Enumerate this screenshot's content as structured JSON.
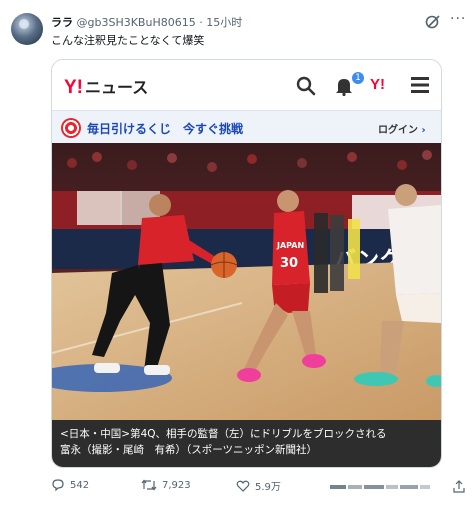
{
  "post": {
    "display_name": "ララ",
    "handle": "@gb3SH3KBuH80615",
    "separator": "·",
    "time": "15小时",
    "text": "こんな注釈見たことなくて爆笑"
  },
  "card": {
    "brand": "Y!",
    "brand_news": "ニュース",
    "notification_count": "1",
    "brand_small": "Y!",
    "promo_text": "毎日引けるくじ　今すぐ挑戦",
    "login_label": "ログイン",
    "login_chevron": "›",
    "photo_jersey_team": "JAPAN",
    "photo_jersey_number": "30",
    "photo_banner_text": "バンク",
    "caption_line1": "<日本・中国>第4Q、相手の監督（左）にドリブルをブロックされる",
    "caption_line2": "富永（撮影・尾崎　有希）（スポーツニッポン新聞社）"
  },
  "actions": {
    "replies": "542",
    "reposts": "7,923",
    "likes": "5.9万"
  },
  "colors": {
    "yahoo_red": "#ff0033",
    "promo_blue": "#1a47b8",
    "caption_bg": "#2d2d2d",
    "secondary_text": "#536471"
  }
}
